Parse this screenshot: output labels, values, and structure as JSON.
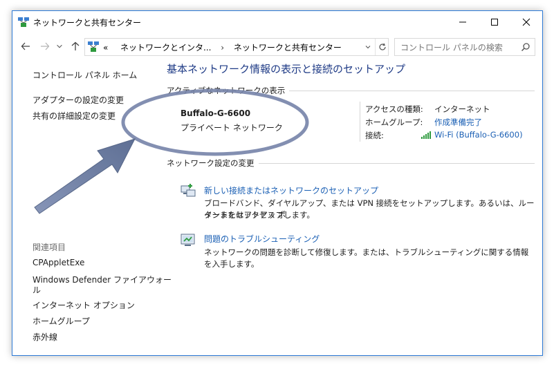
{
  "window": {
    "title": "ネットワークと共有センター",
    "app_icon": "network-center-icon",
    "controls": [
      "minimize-icon",
      "maximize-icon",
      "close-icon"
    ]
  },
  "addressbar": {
    "overflow": "«",
    "crumbs": [
      "ネットワークとインタ...",
      "ネットワークと共有センター"
    ],
    "search_placeholder": "コントロール パネルの検索"
  },
  "sidebar": {
    "top_links": [
      "コントロール パネル ホーム",
      "アダプターの設定の変更",
      "共有の詳細設定の変更"
    ],
    "related_heading": "関連項目",
    "related_links": [
      "CPAppletExe",
      "Windows Defender ファイアウォー",
      "ル",
      "インターネット オプション",
      "ホームグループ",
      "赤外線"
    ]
  },
  "main": {
    "title": "基本ネットワーク情報の表示と接続のセットアップ",
    "active_section": "アクティブなネットワークの表示",
    "network": {
      "name": "Buffalo-G-6600",
      "type": "プライベート ネットワーク",
      "access_type_label": "アクセスの種類:",
      "access_type_value": "インターネット",
      "homegroup_label": "ホームグループ:",
      "homegroup_value": "作成準備完了",
      "connection_label": "接続:",
      "connection_value": "Wi-Fi (Buffalo-G-6600)"
    },
    "change_section": "ネットワーク設定の変更",
    "tasks": [
      {
        "link": "新しい接続またはネットワークのセットアップ",
        "desc1": "ブロードバンド、ダイヤルアップ、または VPN 接続をセットアップします。あるいは、ルーターまたはアクセス ポ",
        "desc2": "イントをセットアップします。"
      },
      {
        "link": "問題のトラブルシューティング",
        "desc1": "ネットワークの問題を診断して修復します。または、トラブルシューティングに関する情報を入手します。"
      }
    ]
  },
  "colors": {
    "accent_border": "#2b79d6",
    "title_blue": "#1f3b86",
    "link_blue": "#1a5fb4",
    "annotation": "#6f7fa6"
  }
}
